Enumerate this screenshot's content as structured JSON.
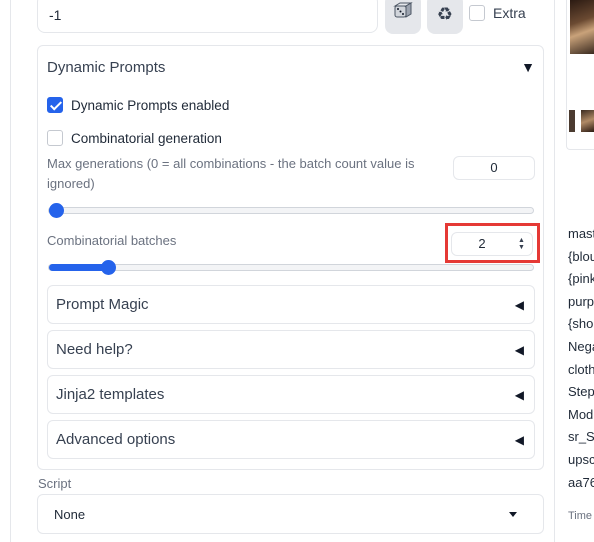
{
  "seed": {
    "value": "-1",
    "dice_icon": "dice-icon",
    "recycle_icon": "recycle-icon",
    "extra_label": "Extra"
  },
  "dynamic_prompts": {
    "title": "Dynamic Prompts",
    "toggle_icon": "▼",
    "enabled_label": "Dynamic Prompts enabled",
    "enabled_checked": true,
    "combinatorial_label": "Combinatorial generation",
    "combinatorial_checked": false,
    "max_generations_label": "Max generations (0 = all combinations - the batch count value is ignored)",
    "max_generations_value": "0",
    "max_generations_fraction": 0.0,
    "combinatorial_batches_label": "Combinatorial batches",
    "combinatorial_batches_value": "2",
    "combinatorial_batches_fraction": 0.11,
    "sections": [
      {
        "label": "Prompt Magic",
        "arrow": "◀"
      },
      {
        "label": "Need help?",
        "arrow": "◀"
      },
      {
        "label": "Jinja2 templates",
        "arrow": "◀"
      },
      {
        "label": "Advanced options",
        "arrow": "◀"
      }
    ]
  },
  "script": {
    "label": "Script",
    "value": "None"
  },
  "output_info": {
    "lines": [
      "mast",
      "{blou",
      "{pink",
      "purp",
      "{sho",
      "Nega",
      "cloth",
      "Step",
      "Mod",
      "sr_S",
      "upsc",
      "aa76"
    ],
    "time_label": "Time"
  },
  "colors": {
    "accent": "#2563eb",
    "highlight": "#e53935",
    "border": "#e5e7eb"
  }
}
